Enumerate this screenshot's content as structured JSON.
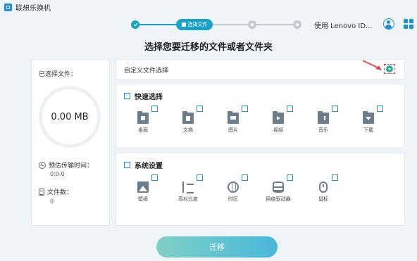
{
  "window": {
    "title": "联想乐换机"
  },
  "stepper": {
    "current_step_label": "选择文件"
  },
  "header": {
    "device_name": "使用 Lenovo ID..."
  },
  "heading": "选择您要迁移的文件或者文件夹",
  "summary": {
    "selected_label": "已选择文件：",
    "size_value": "0.00 MB",
    "time_label": "预估传输时间：",
    "time_value": "0:0:0",
    "count_label": "文件数：",
    "count_value": "0"
  },
  "custom": {
    "label": "自定义文件选择"
  },
  "quick": {
    "title": "快速选择",
    "items": [
      {
        "label": "桌面",
        "icon": "desktop-folder-icon"
      },
      {
        "label": "文档",
        "icon": "documents-folder-icon"
      },
      {
        "label": "图片",
        "icon": "pictures-folder-icon"
      },
      {
        "label": "视频",
        "icon": "videos-folder-icon"
      },
      {
        "label": "音乐",
        "icon": "music-folder-icon"
      },
      {
        "label": "下载",
        "icon": "downloads-folder-icon"
      }
    ]
  },
  "system": {
    "title": "系统设置",
    "items": [
      {
        "label": "壁纸",
        "icon": "wallpaper-icon"
      },
      {
        "label": "高对比度",
        "icon": "contrast-icon"
      },
      {
        "label": "时区",
        "icon": "globe-icon"
      },
      {
        "label": "网络驱动器",
        "icon": "network-drive-icon"
      },
      {
        "label": "鼠标",
        "icon": "mouse-icon"
      }
    ]
  },
  "actions": {
    "migrate_label": "迁移"
  },
  "colors": {
    "accent": "#1aa2c8",
    "button_start": "#7fd0c4",
    "button_end": "#47b7da",
    "annotation": "#e24b4b"
  }
}
